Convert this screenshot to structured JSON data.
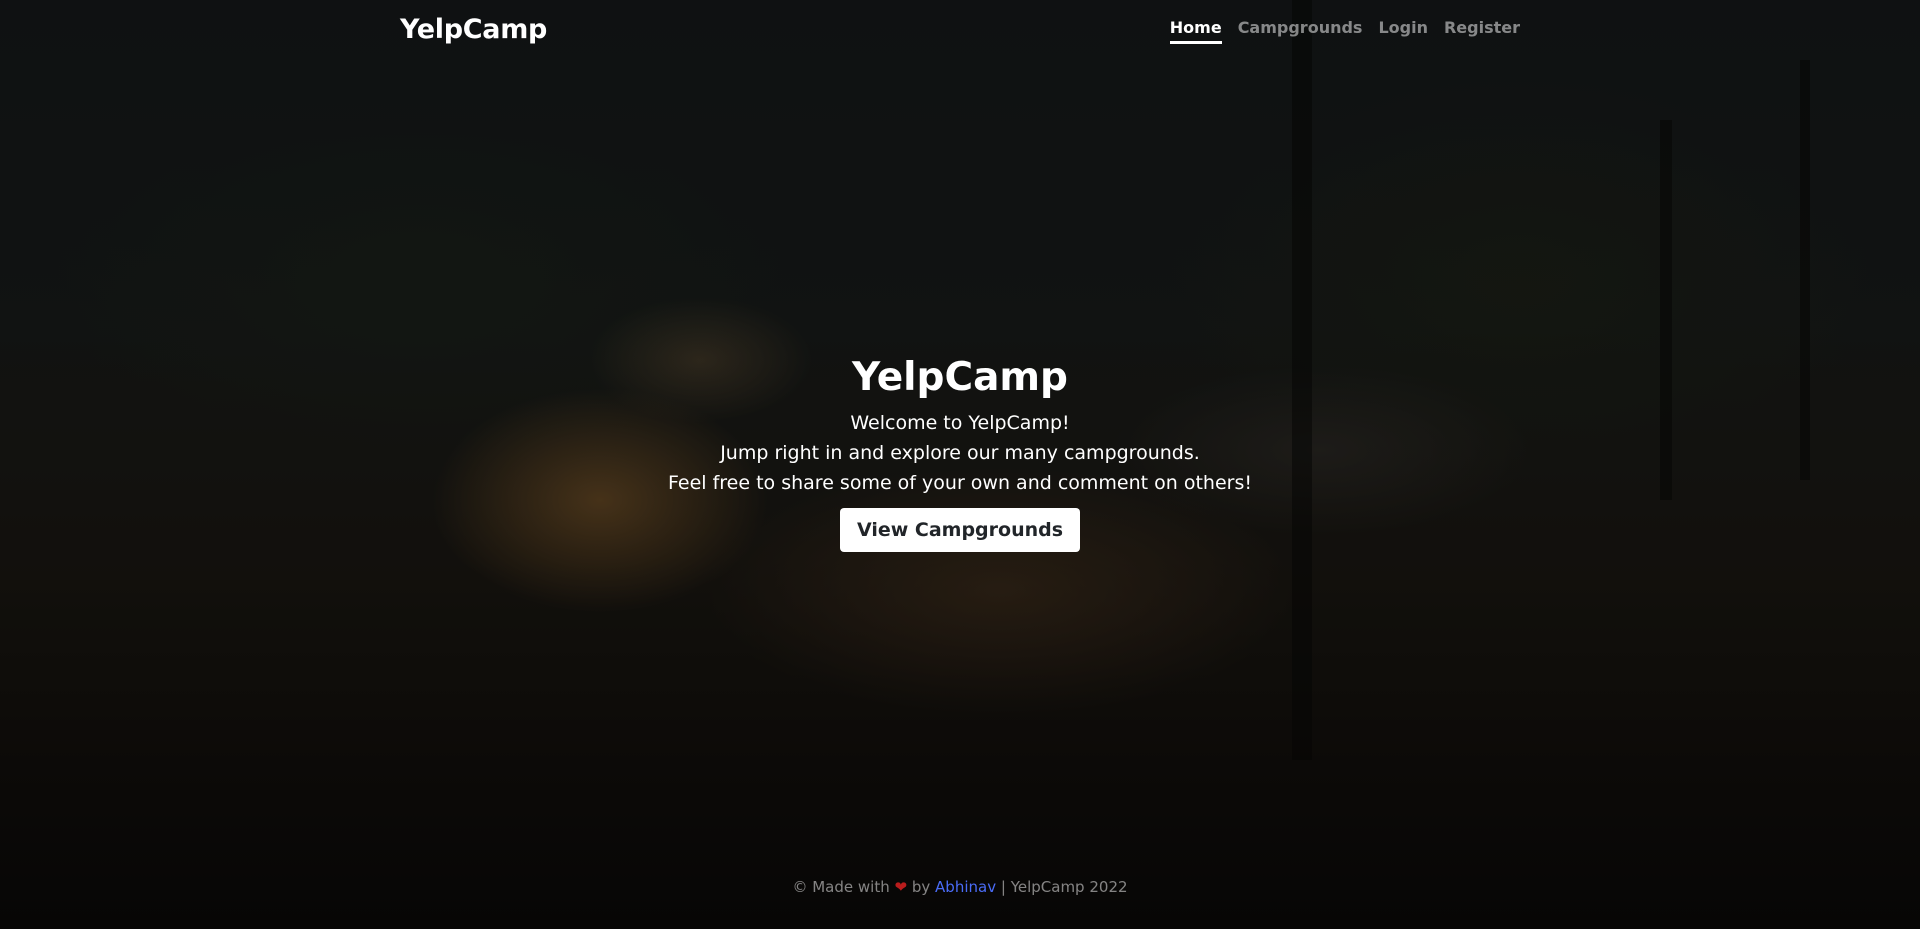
{
  "header": {
    "brand": "YelpCamp",
    "nav": [
      {
        "label": "Home"
      },
      {
        "label": "Campgrounds"
      },
      {
        "label": "Login"
      },
      {
        "label": "Register"
      }
    ]
  },
  "hero": {
    "title": "YelpCamp",
    "lines": [
      "Welcome to YelpCamp!",
      "Jump right in and explore our many campgrounds.",
      "Feel free to share some of your own and comment on others!"
    ],
    "button_label": "View Campgrounds"
  },
  "footer": {
    "prefix": "© Made with",
    "heart_icon": "heart-icon",
    "by": "by",
    "author": "Abhinav",
    "suffix": "| YelpCamp 2022"
  },
  "colors": {
    "link_blue": "#4a6cf7",
    "heart_red": "#b91c1c"
  }
}
